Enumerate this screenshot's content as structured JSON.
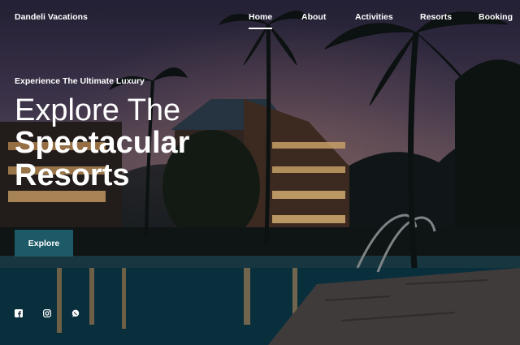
{
  "brand": "Dandeli Vacations",
  "nav": {
    "items": [
      {
        "label": "Home",
        "active": true
      },
      {
        "label": "About",
        "active": false
      },
      {
        "label": "Activities",
        "active": false
      },
      {
        "label": "Resorts",
        "active": false
      },
      {
        "label": "Booking",
        "active": false
      }
    ]
  },
  "hero": {
    "eyebrow": "Experience The Ultimate Luxury",
    "title_line1": "Explore The",
    "title_line2": "Spectacular",
    "title_line3": "Resorts",
    "cta_label": "Explore"
  },
  "social": {
    "icons": [
      "facebook-icon",
      "instagram-icon",
      "whatsapp-icon"
    ]
  },
  "colors": {
    "accent": "#1d5a68",
    "text": "#ffffff"
  }
}
